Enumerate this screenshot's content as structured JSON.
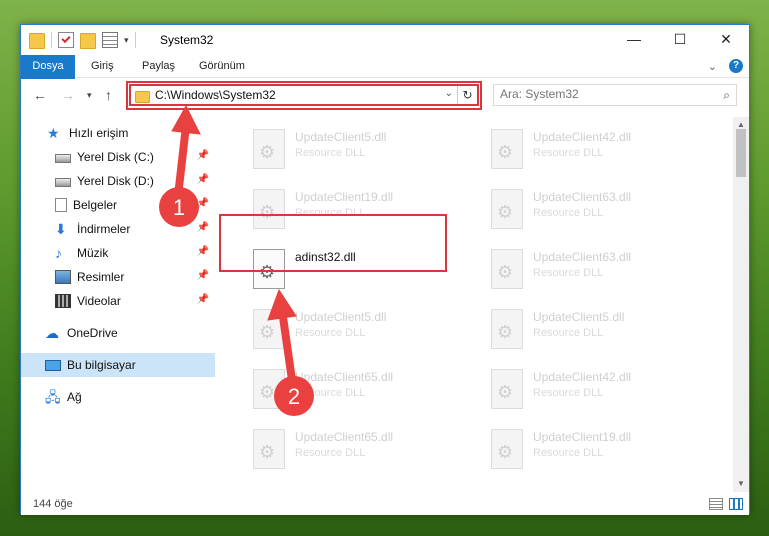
{
  "window": {
    "title": "System32"
  },
  "title_buttons": [
    "minimize-icon",
    "maximize-icon",
    "close-icon"
  ],
  "ribbon": {
    "tabs": [
      {
        "label": "Dosya"
      },
      {
        "label": "Giriş"
      },
      {
        "label": "Paylaş"
      },
      {
        "label": "Görünüm"
      }
    ]
  },
  "address": {
    "path": "C:\\Windows\\System32",
    "search_placeholder": "Ara: System32"
  },
  "nav": {
    "quick_access": "Hızlı erişim",
    "items": [
      {
        "label": "Yerel Disk (C:)",
        "icon": "disk-icon"
      },
      {
        "label": "Yerel Disk (D:)",
        "icon": "disk-icon"
      },
      {
        "label": "Belgeler",
        "icon": "document-icon"
      },
      {
        "label": "İndirmeler",
        "icon": "download-icon"
      },
      {
        "label": "Müzik",
        "icon": "music-icon"
      },
      {
        "label": "Resimler",
        "icon": "pictures-icon"
      },
      {
        "label": "Videolar",
        "icon": "videos-icon"
      }
    ],
    "onedrive": "OneDrive",
    "this_pc": "Bu bilgisayar",
    "network": "Ağ"
  },
  "files": {
    "left": [
      {
        "name": "UpdateClient5.dll",
        "type": "Resource DLL"
      },
      {
        "name": "UpdateClient19.dll",
        "type": "Resource DLL"
      },
      {
        "name": "adinst32.dll",
        "type": ""
      },
      {
        "name": "UpdateClient5.dll",
        "type": "Resource DLL"
      },
      {
        "name": "UpdateClient65.dll",
        "type": "Resource DLL"
      },
      {
        "name": "UpdateClient65.dll",
        "type": "Resource DLL"
      }
    ],
    "right": [
      {
        "name": "UpdateClient42.dll",
        "type": "Resource DLL"
      },
      {
        "name": "UpdateClient63.dll",
        "type": "Resource DLL"
      },
      {
        "name": "UpdateClient63.dll",
        "type": "Resource DLL"
      },
      {
        "name": "UpdateClient5.dll",
        "type": "Resource DLL"
      },
      {
        "name": "UpdateClient42.dll",
        "type": "Resource DLL"
      },
      {
        "name": "UpdateClient19.dll",
        "type": "Resource DLL"
      }
    ]
  },
  "status": {
    "item_count": "144 öğe"
  },
  "annotations": {
    "marker1": "1",
    "marker2": "2",
    "color": "#e8413f"
  }
}
